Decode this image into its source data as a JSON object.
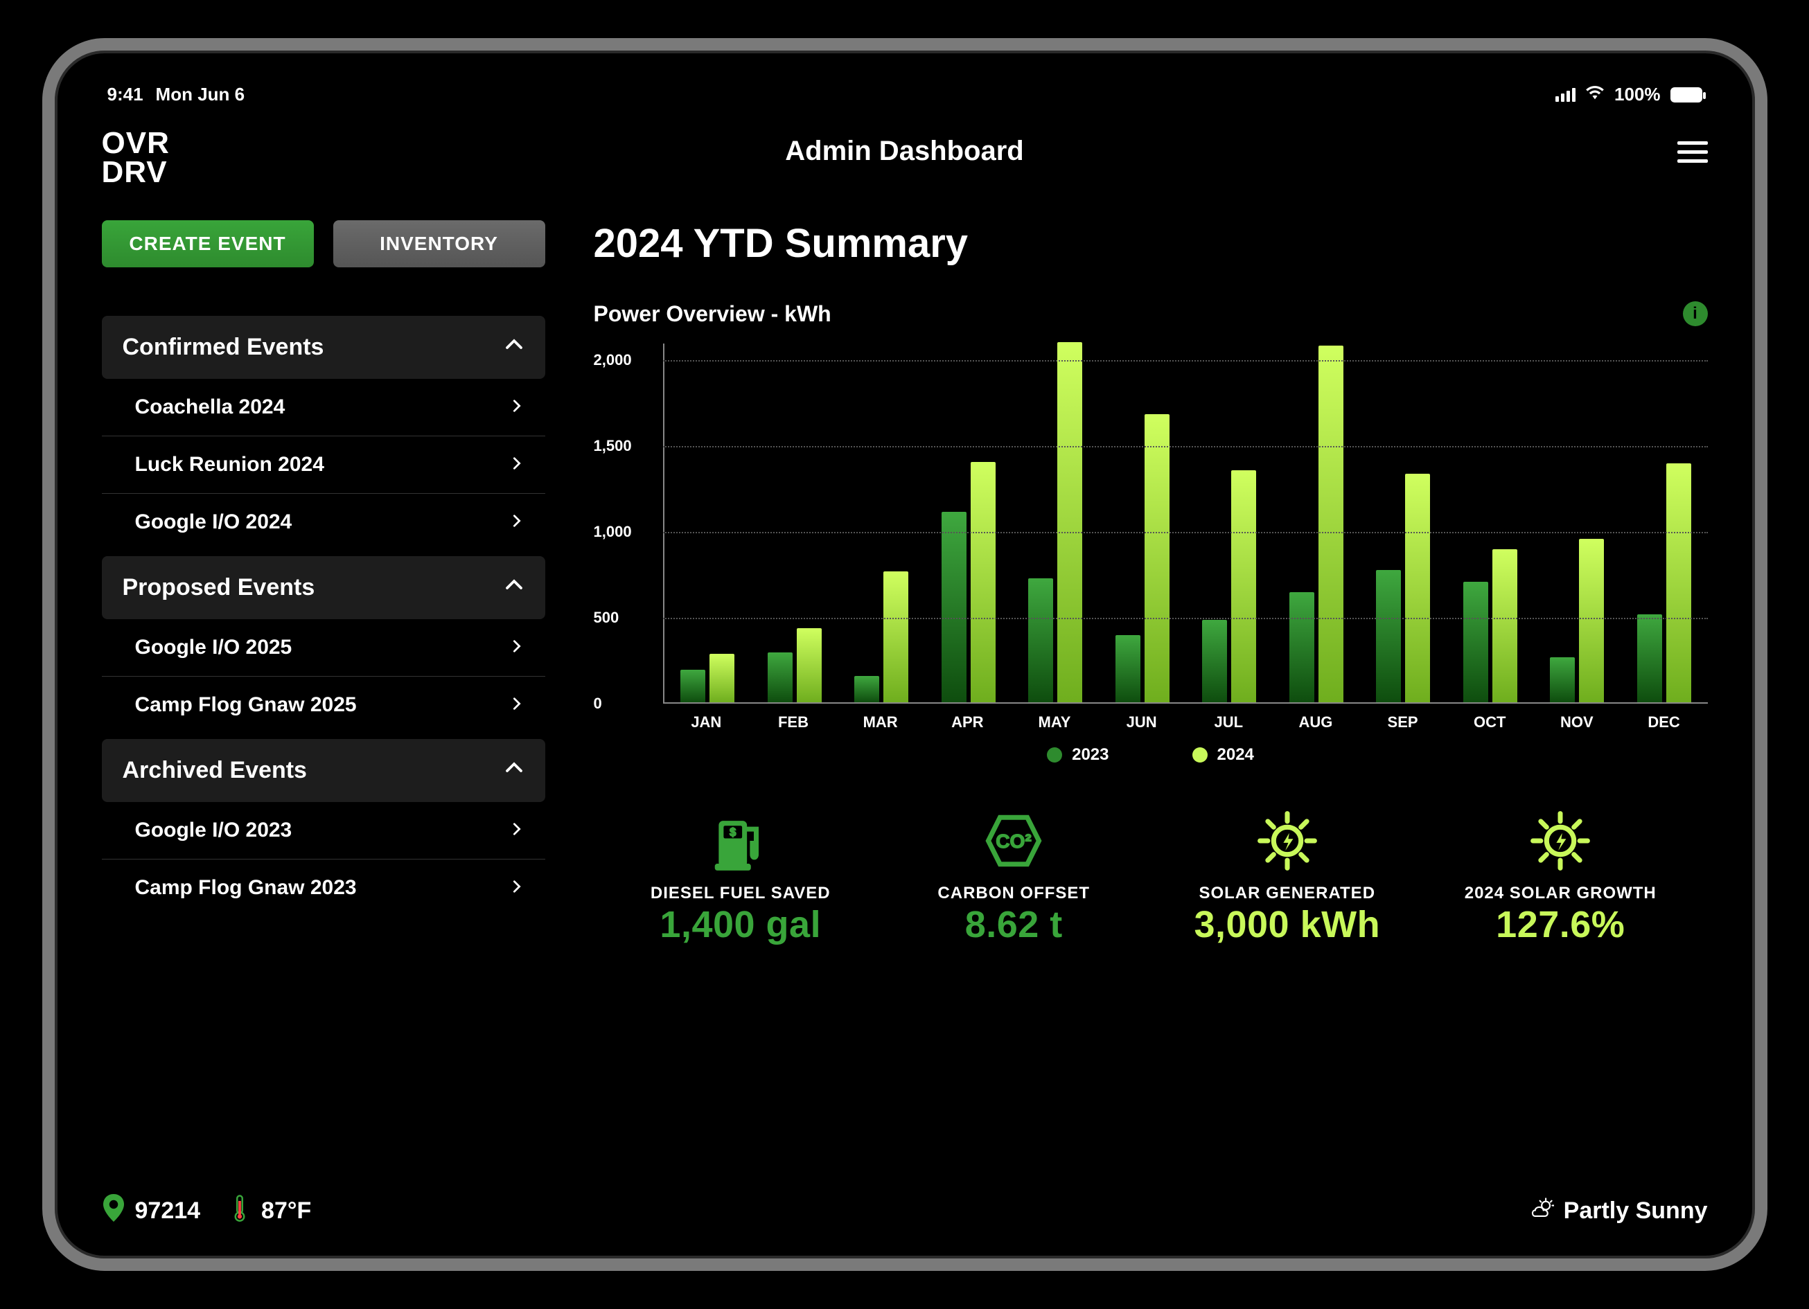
{
  "status_bar": {
    "time": "9:41",
    "date": "Mon Jun 6",
    "battery_pct": "100%"
  },
  "logo": {
    "line1": "OVR",
    "line2": "DRV"
  },
  "header": {
    "title": "Admin Dashboard"
  },
  "sidebar": {
    "create_event_label": "CREATE EVENT",
    "inventory_label": "INVENTORY",
    "sections": [
      {
        "title": "Confirmed Events",
        "items": [
          "Coachella 2024",
          "Luck Reunion 2024",
          "Google I/O 2024"
        ]
      },
      {
        "title": "Proposed Events",
        "items": [
          "Google I/O 2025",
          "Camp Flog Gnaw 2025"
        ]
      },
      {
        "title": "Archived Events",
        "items": [
          "Google I/O 2023",
          "Camp Flog Gnaw 2023"
        ]
      }
    ]
  },
  "content": {
    "summary_title": "2024 YTD Summary",
    "chart_title": "Power Overview - kWh",
    "legend": {
      "a": "2023",
      "b": "2024"
    },
    "kpis": [
      {
        "label": "DIESEL FUEL SAVED",
        "value": "1,400 gal"
      },
      {
        "label": "CARBON OFFSET",
        "value": "8.62 t"
      },
      {
        "label": "SOLAR GENERATED",
        "value": "3,000 kWh"
      },
      {
        "label": "2024 SOLAR GROWTH",
        "value": "127.6%"
      }
    ]
  },
  "footer": {
    "zip": "97214",
    "temp": "87°F",
    "weather": "Partly Sunny"
  },
  "chart_data": {
    "type": "bar",
    "title": "Power Overview - kWh",
    "xlabel": "",
    "ylabel": "kWh",
    "ylim": [
      0,
      2100
    ],
    "y_ticks": [
      0,
      500,
      1000,
      1500,
      2000
    ],
    "categories": [
      "JAN",
      "FEB",
      "MAR",
      "APR",
      "MAY",
      "JUN",
      "JUL",
      "AUG",
      "SEP",
      "OCT",
      "NOV",
      "DEC"
    ],
    "series": [
      {
        "name": "2023",
        "values": [
          190,
          290,
          150,
          1110,
          720,
          390,
          480,
          640,
          770,
          700,
          260,
          510
        ]
      },
      {
        "name": "2024",
        "values": [
          280,
          430,
          760,
          1400,
          2100,
          1680,
          1350,
          2080,
          1330,
          890,
          950,
          1390
        ]
      }
    ],
    "legend_position": "bottom",
    "grid": true
  }
}
